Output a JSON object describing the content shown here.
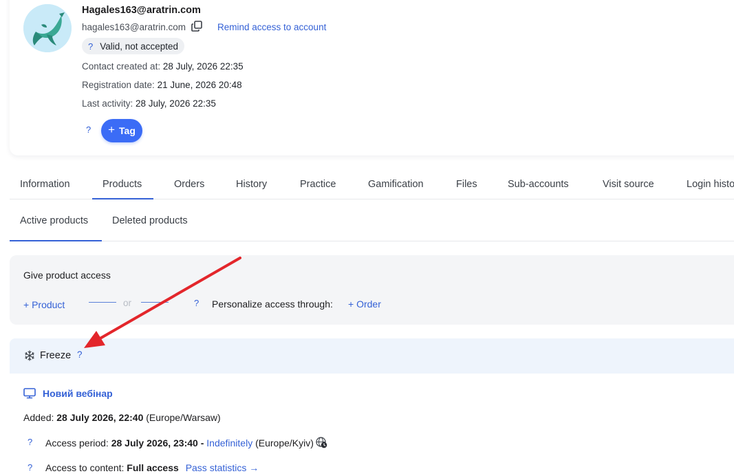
{
  "profile": {
    "name": "Hagales163@aratrin.com",
    "email": "hagales163@aratrin.com",
    "remind_link": "Remind access to account",
    "status_help": "?",
    "status": "Valid, not accepted",
    "contact_created_label": "Contact created at: ",
    "contact_created_value": "28 July, 2026 22:35",
    "registration_label": "Registration date: ",
    "registration_value": "21 June, 2026 20:48",
    "last_activity_label": "Last activity: ",
    "last_activity_value": "28 July, 2026 22:35",
    "tag_help": "?",
    "tag_button_plus": "+",
    "tag_button_label": "Tag"
  },
  "tabs": [
    "Information",
    "Products",
    "Orders",
    "History",
    "Practice",
    "Gamification",
    "Files",
    "Sub-accounts",
    "Visit source",
    "Login history"
  ],
  "active_tab": "Products",
  "subtabs": [
    "Active products",
    "Deleted products"
  ],
  "give_access": {
    "title": "Give product access",
    "product_link": "+ Product",
    "or": "or",
    "help": "?",
    "personalize_label": "Personalize access through:",
    "order_link": "+ Order"
  },
  "freeze": {
    "icon": "snowflake-icon",
    "label": "Freeze",
    "help": "?"
  },
  "product": {
    "icon": "monitor-icon",
    "name": "Новий вебінар",
    "added_label": "Added: ",
    "added_value": "28 July 2026, 22:40",
    "added_tz": " (Europe/Warsaw)",
    "access_help": "?",
    "access_period_label": "Access period: ",
    "access_period_value": "28 July 2026, 23:40 - ",
    "access_period_end": "Indefinitely",
    "access_tz": " (Europe/Kyiv)",
    "content_help": "?",
    "content_label": "Access to content: ",
    "content_value": "Full access",
    "pass_stats_link": "Pass statistics →"
  },
  "colors": {
    "accent": "#3461d6",
    "tag_button": "#3b6cf6",
    "annotation_arrow": "#e3262b"
  }
}
